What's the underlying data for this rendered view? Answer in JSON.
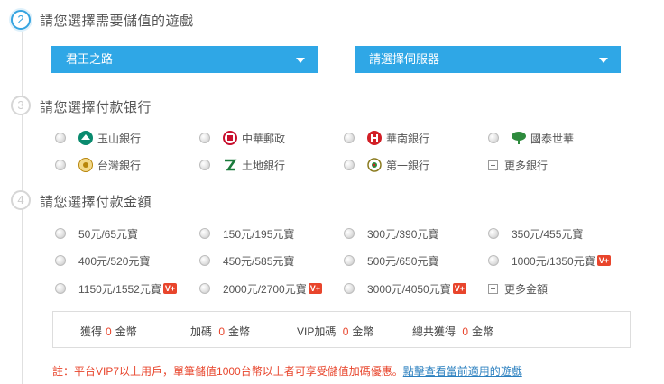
{
  "steps": {
    "game": {
      "number": "2",
      "title": "請您選擇需要儲值的遊戲"
    },
    "bank": {
      "number": "3",
      "title": "請您選擇付款银行"
    },
    "amount": {
      "number": "4",
      "title": "請您選擇付款金額"
    }
  },
  "selects": {
    "game": {
      "value": "君王之路"
    },
    "server": {
      "value": "請選擇伺服器"
    }
  },
  "banks": [
    {
      "label": "玉山銀行",
      "icon": "esun-bank-logo",
      "color": "#0a8a6e"
    },
    {
      "label": "中華郵政",
      "icon": "chunghwa-post-logo",
      "color": "#c8102e"
    },
    {
      "label": "華南銀行",
      "icon": "hua-nan-bank-logo",
      "color": "#d21f26"
    },
    {
      "label": "國泰世華",
      "icon": "cathay-bank-logo",
      "color": "#2e8b3d"
    },
    {
      "label": "台灣銀行",
      "icon": "bank-of-taiwan-logo",
      "color": "#b8860b"
    },
    {
      "label": "土地銀行",
      "icon": "land-bank-logo",
      "color": "#1a7a3b"
    },
    {
      "label": "第一銀行",
      "icon": "first-bank-logo",
      "color": "#8a7a1e"
    }
  ],
  "more_banks": "更多銀行",
  "amounts": [
    {
      "label": "50元/65元寶",
      "vplus": ""
    },
    {
      "label": "150元/195元寶",
      "vplus": ""
    },
    {
      "label": "300元/390元寶",
      "vplus": ""
    },
    {
      "label": "350元/455元寶",
      "vplus": ""
    },
    {
      "label": "400元/520元寶",
      "vplus": ""
    },
    {
      "label": "450元/585元寶",
      "vplus": ""
    },
    {
      "label": "500元/650元寶",
      "vplus": ""
    },
    {
      "label": "1000元/1350元寶",
      "vplus": "V+"
    },
    {
      "label": "1150元/1552元寶",
      "vplus": "V+"
    },
    {
      "label": "2000元/2700元寶",
      "vplus": "V+"
    },
    {
      "label": "3000元/4050元寶",
      "vplus": "V+"
    }
  ],
  "more_amounts": "更多金額",
  "summary": {
    "get": {
      "label": "獲得",
      "value": "0",
      "unit": "金幣"
    },
    "bonus": {
      "label": "加碼",
      "value": "0",
      "unit": "金幣"
    },
    "vip": {
      "label": "VIP加碼",
      "value": "0",
      "unit": "金幣"
    },
    "total": {
      "label": "總共獲得",
      "value": "0",
      "unit": "金幣"
    }
  },
  "note": {
    "text": "註：平台VIP7以上用戶，單筆儲值1000台幣以上者可享受儲值加碼優惠。",
    "link": "點擊查看當前適用的遊戲"
  },
  "colors": {
    "accent": "#2fa7e6",
    "highlight": "#e8452c",
    "link": "#2a7fbf"
  }
}
